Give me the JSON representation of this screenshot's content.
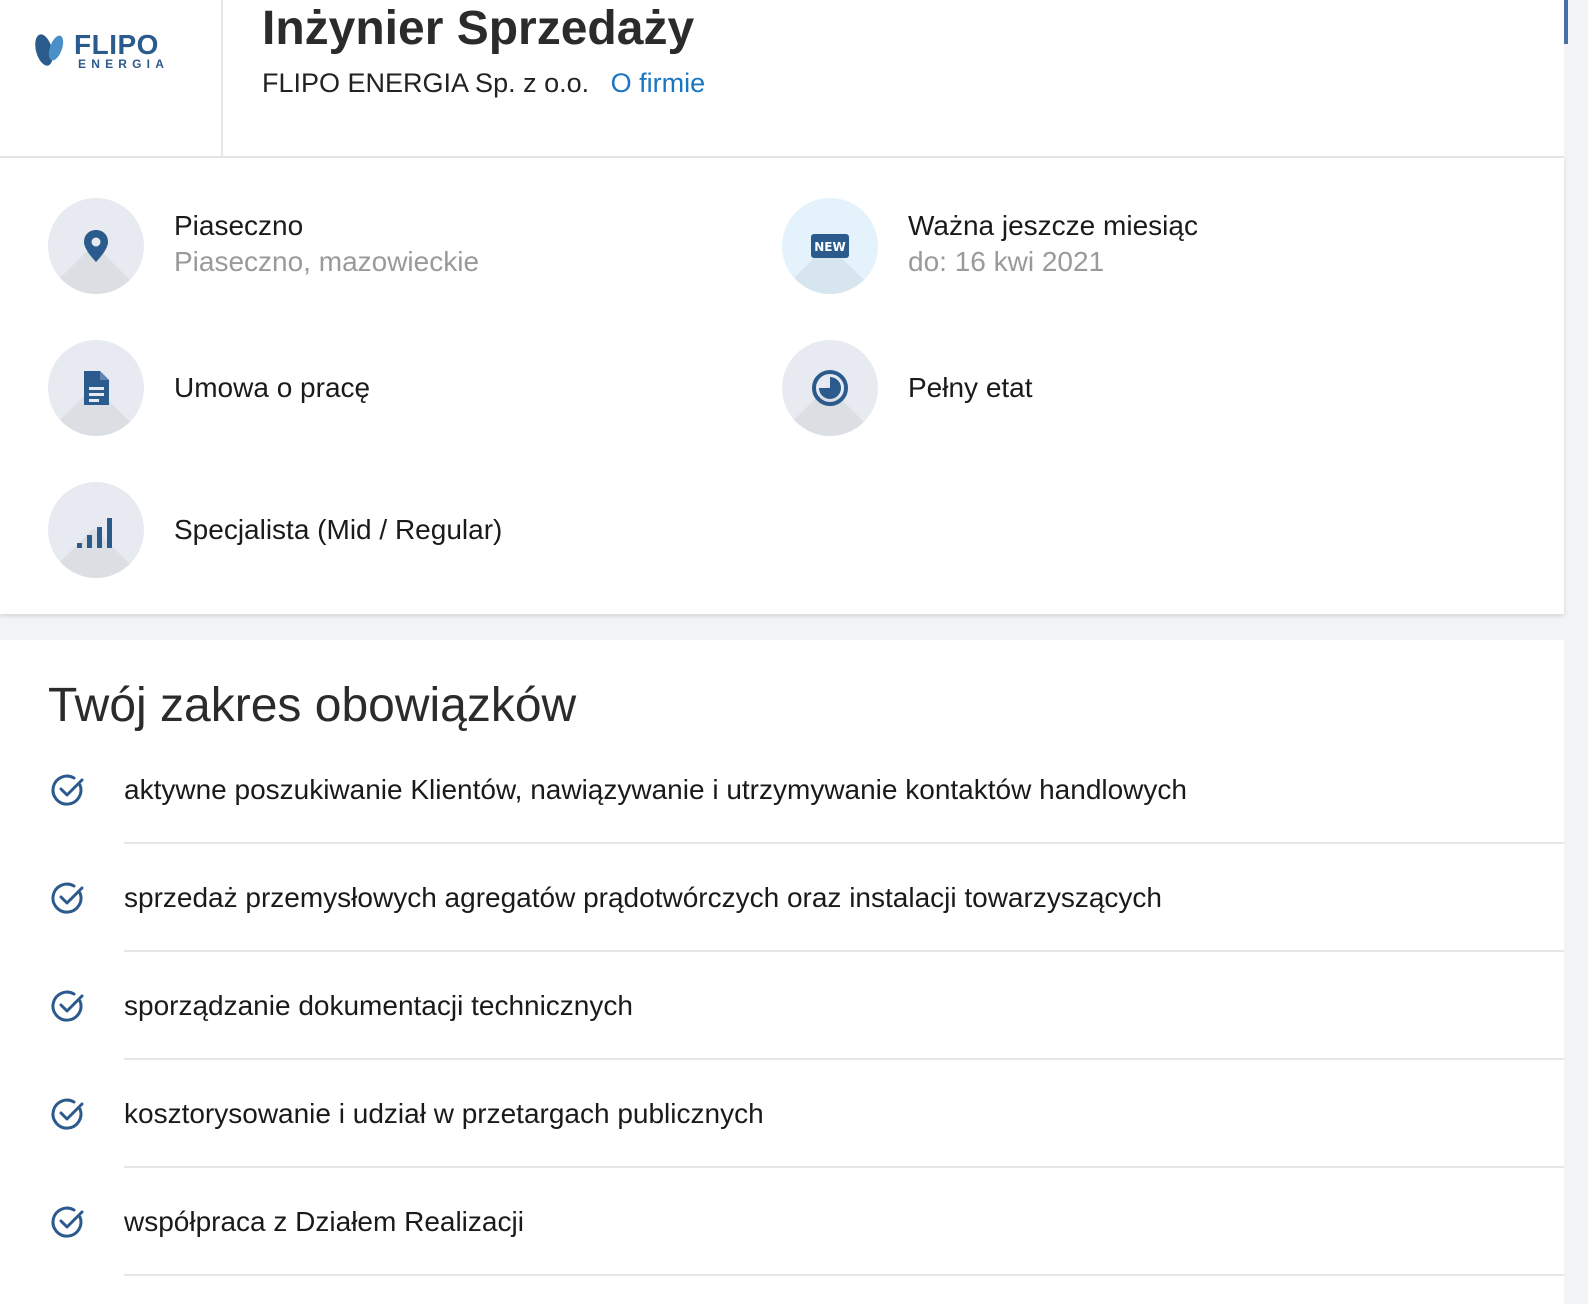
{
  "header": {
    "logo": {
      "name": "FLIPO",
      "sub": "ENERGIA"
    },
    "title": "Inżynier Sprzedaży",
    "company": "FLIPO ENERGIA Sp. z o.o.",
    "about_link": "O firmie"
  },
  "info": {
    "location": {
      "main": "Piaseczno",
      "sub": "Piaseczno, mazowieckie",
      "icon": "location-pin-icon"
    },
    "validity": {
      "main": "Ważna jeszcze miesiąc",
      "sub": "do: 16 kwi 2021",
      "icon": "new-badge-icon",
      "badge": "NEW"
    },
    "contract": {
      "main": "Umowa o pracę",
      "icon": "document-icon"
    },
    "worktime": {
      "main": "Pełny etat",
      "icon": "clock-icon"
    },
    "level": {
      "main": "Specjalista (Mid / Regular)",
      "icon": "signal-bars-icon"
    }
  },
  "responsibilities": {
    "title": "Twój zakres obowiązków",
    "items": [
      "aktywne poszukiwanie Klientów, nawiązywanie i utrzymywanie kontaktów handlowych",
      "sprzedaż przemysłowych agregatów prądotwórczych oraz instalacji towarzyszących",
      "sporządzanie dokumentacji technicznych",
      "kosztorysowanie i udział w przetargach publicznych",
      "współpraca z Działem Realizacji"
    ]
  },
  "colors": {
    "icon_blue": "#2b5a8c",
    "link_blue": "#1a75c4",
    "muted_text": "#9a9a9a"
  }
}
